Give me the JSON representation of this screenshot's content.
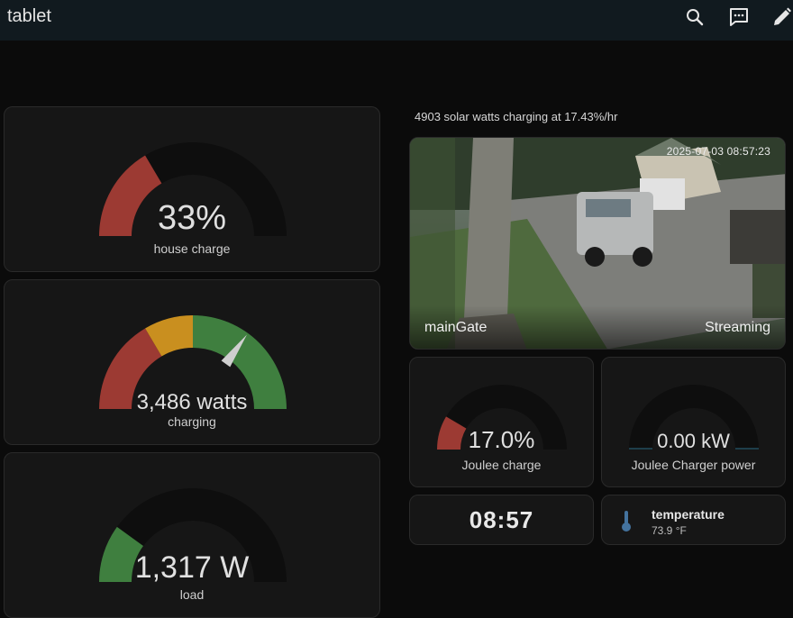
{
  "header": {
    "title": "tablet",
    "icons": [
      "search-icon",
      "chat-icon",
      "pencil-icon"
    ]
  },
  "gauges": {
    "house_charge": {
      "value_text": "33%",
      "label": "house charge",
      "level": 0.33,
      "segments": [
        {
          "color": "#9c3a33",
          "from": 0,
          "to": 0.33
        }
      ]
    },
    "charging": {
      "value_text": "3,486 watts",
      "label": "charging",
      "level": 0.7,
      "segments": [
        {
          "color": "#9c3a33",
          "from": 0,
          "to": 0.33
        },
        {
          "color": "#c98f1f",
          "from": 0.33,
          "to": 0.5
        },
        {
          "color": "#3f7f3f",
          "from": 0.5,
          "to": 1.0
        }
      ],
      "needle": true
    },
    "load": {
      "value_text": "1,317 W",
      "label": "load",
      "level": 0.2,
      "segments": [
        {
          "color": "#3f7f3f",
          "from": 0,
          "to": 0.2
        }
      ]
    },
    "joulee_charge": {
      "value_text": "17.0%",
      "label": "Joulee charge",
      "level": 0.17,
      "segments": [
        {
          "color": "#9c3a33",
          "from": 0,
          "to": 0.17
        }
      ]
    },
    "joulee_power": {
      "value_text": "0.00 kW",
      "label": "Joulee Charger power",
      "level": 0.0,
      "segments": []
    }
  },
  "camera": {
    "caption": "4903 solar watts charging at 17.43%/hr",
    "name": "mainGate",
    "state": "Streaming",
    "timestamp": "2025-07-03 08:57:23"
  },
  "clock": {
    "time": "08:57"
  },
  "temperature": {
    "name": "temperature",
    "value": "73.9 °F"
  },
  "colors": {
    "track": "#0e0e0e",
    "card": "#161616",
    "red": "#9c3a33",
    "amber": "#c98f1f",
    "green": "#3f7f3f"
  }
}
